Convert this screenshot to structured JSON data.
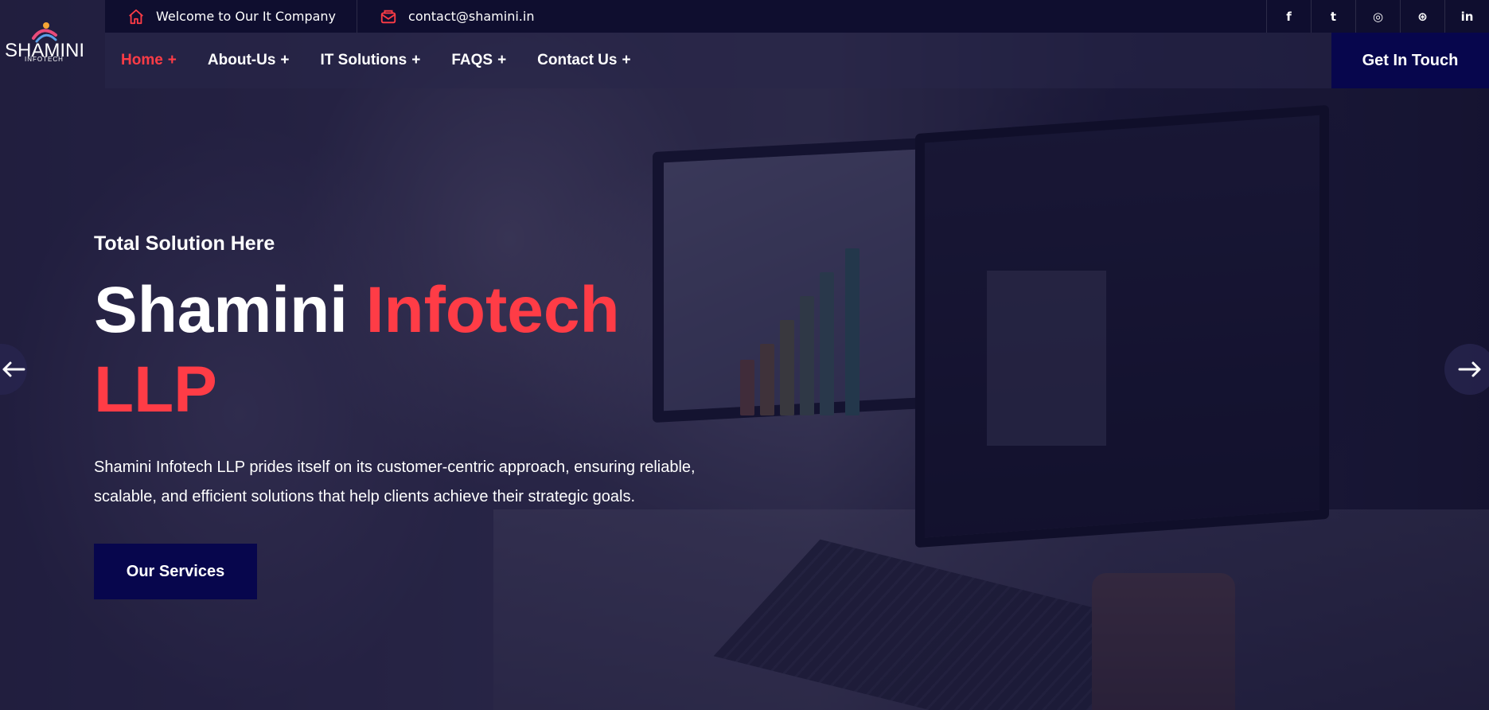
{
  "topbar": {
    "welcome": "Welcome to Our It Company",
    "email": "contact@shamini.in",
    "social": [
      {
        "name": "facebook",
        "glyph": "f"
      },
      {
        "name": "twitter",
        "glyph": "t"
      },
      {
        "name": "instagram",
        "glyph": "◎"
      },
      {
        "name": "dribbble",
        "glyph": "⊛"
      },
      {
        "name": "linkedin",
        "glyph": "in"
      }
    ]
  },
  "logo": {
    "main": "SHAMINI",
    "sub": "INFOTECH"
  },
  "nav": {
    "items": [
      {
        "label": "Home",
        "plus": "+"
      },
      {
        "label": "About-Us",
        "plus": "+"
      },
      {
        "label": "IT Solutions",
        "plus": "+"
      },
      {
        "label": "FAQS",
        "plus": "+"
      },
      {
        "label": "Contact Us",
        "plus": "+"
      }
    ],
    "cta": "Get In Touch"
  },
  "hero": {
    "subtitle": "Total Solution Here",
    "title_white": "Shamini ",
    "title_accent_1": "Infotech",
    "title_accent_2": "LLP",
    "description": "Shamini Infotech LLP prides itself on its customer-centric approach, ensuring reliable, scalable, and efficient solutions that help clients achieve their strategic goals.",
    "button": "Our Services"
  },
  "colors": {
    "accent": "#ff3c46",
    "navy": "#07064d",
    "topbar": "#0f0e2f"
  },
  "icons": {
    "home": "home-icon",
    "mail": "mail-icon",
    "prev": "arrow-left-icon",
    "next": "arrow-right-icon"
  }
}
